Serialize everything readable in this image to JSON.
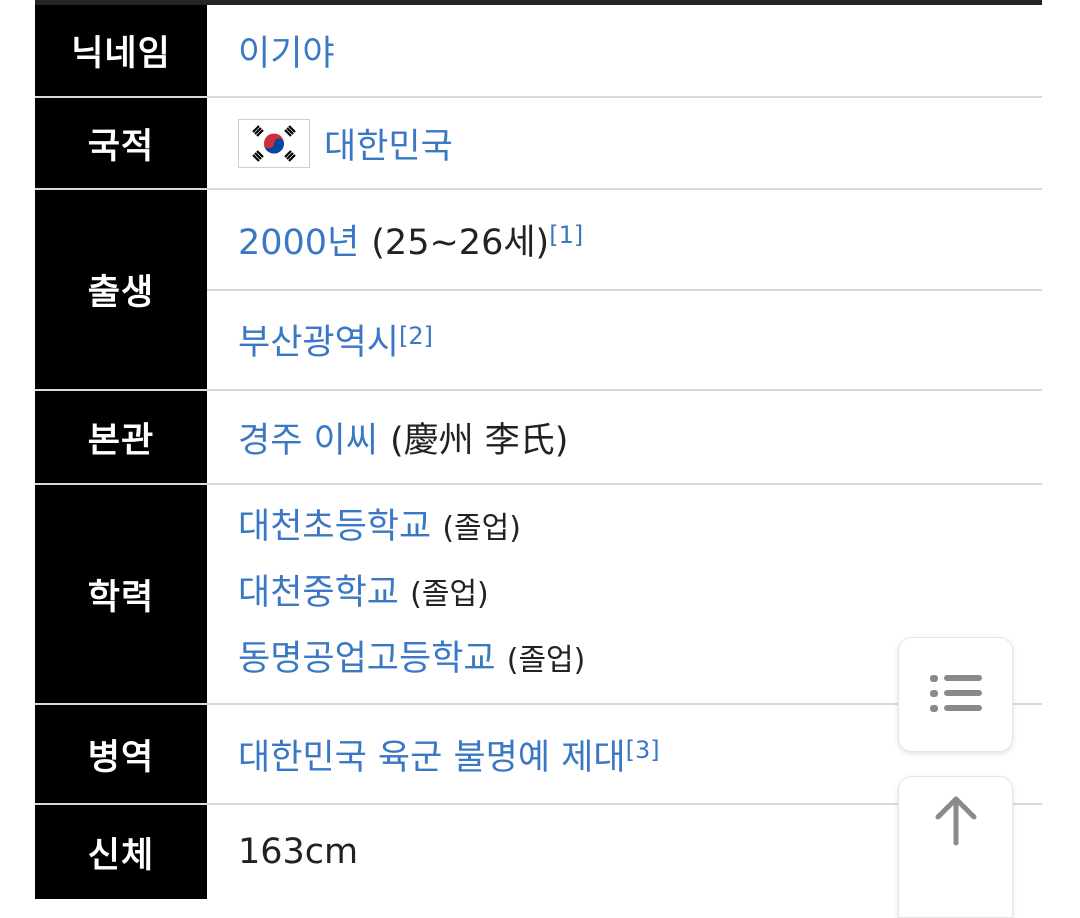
{
  "infobox": {
    "rows": [
      {
        "label": "닉네임",
        "value": "이기야"
      },
      {
        "label": "국적",
        "flag_icon": "south-korea-flag-icon",
        "value": "대한민국"
      },
      {
        "label": "출생",
        "birth_year": "2000년",
        "age": "(25~26세)",
        "birth_ref": "[1]",
        "birthplace": "부산광역시",
        "birthplace_ref": "[2]"
      },
      {
        "label": "본관",
        "value_link": "경주 이씨",
        "value_hanja": "(慶州 李氏)"
      },
      {
        "label": "학력",
        "schools": [
          {
            "name": "대천초등학교",
            "status": "(졸업)"
          },
          {
            "name": "대천중학교",
            "status": "(졸업)"
          },
          {
            "name": "동명공업고등학교",
            "status": "(졸업)"
          }
        ]
      },
      {
        "label": "병역",
        "value": "대한민국 육군 불명예 제대",
        "ref": "[3]"
      },
      {
        "label": "신체",
        "value": "163cm"
      }
    ]
  },
  "floating": {
    "toc_icon": "list-icon",
    "top_icon": "arrow-up-icon"
  },
  "colors": {
    "link": "#3a77c4",
    "label_bg": "#000000",
    "label_text": "#ffffff"
  }
}
